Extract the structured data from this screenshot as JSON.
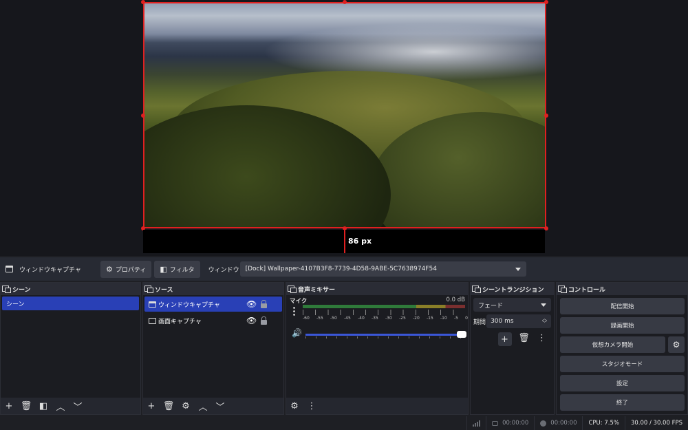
{
  "preview": {
    "distance_label": "86 px"
  },
  "context_bar": {
    "source_title": "ウィンドウキャプチャ",
    "properties_label": "プロパティ",
    "filters_label": "フィルタ",
    "window_label": "ウィンドウ",
    "window_value": "[Dock] Wallpaper-4107B3F8-7739-4D58-9ABE-5C7638974F54"
  },
  "scenes": {
    "title": "シーン",
    "items": [
      {
        "label": "シーン",
        "selected": true
      }
    ]
  },
  "sources": {
    "title": "ソース",
    "items": [
      {
        "label": "ウィンドウキャプチャ",
        "selected": true,
        "icon": "window-icon"
      },
      {
        "label": "画面キャプチャ",
        "selected": false,
        "icon": "monitor-icon"
      }
    ]
  },
  "mixer": {
    "title": "音声ミキサー",
    "channel": "マイク",
    "db": "0.0 dB",
    "scale": [
      "-60",
      "-55",
      "-50",
      "-45",
      "-40",
      "-35",
      "-30",
      "-25",
      "-20",
      "-15",
      "-10",
      "-5",
      "0"
    ],
    "volume_fraction": 1.0
  },
  "transitions": {
    "title": "シーントランジション",
    "type": "フェード",
    "duration_label": "期間",
    "duration_value": "300 ms"
  },
  "controls": {
    "title": "コントロール",
    "start_streaming": "配信開始",
    "start_recording": "録画開始",
    "start_virtual_camera": "仮想カメラ開始",
    "studio_mode": "スタジオモード",
    "settings": "設定",
    "exit": "終了"
  },
  "status": {
    "stream_time": "00:00:00",
    "rec_time": "00:00:00",
    "cpu": "CPU: 7.5%",
    "fps": "30.00 / 30.00 FPS"
  },
  "colors": {
    "selection": "#e02020",
    "accent": "#2940b6",
    "background": "#1e1f24"
  }
}
